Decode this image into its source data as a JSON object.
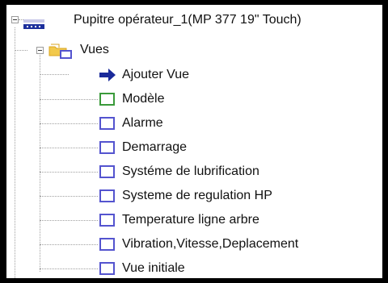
{
  "tree": {
    "root": {
      "label": "Pupitre opérateur_1(MP 377 19\" Touch)",
      "icon": "hmi-device-icon"
    },
    "folder": {
      "label": "Vues",
      "icon": "folder-screens-icon"
    },
    "items": [
      {
        "label": "Ajouter Vue",
        "icon": "add-arrow-icon"
      },
      {
        "label": "Modèle",
        "icon": "template-icon"
      },
      {
        "label": "Alarme",
        "icon": "screen-icon"
      },
      {
        "label": "Demarrage",
        "icon": "screen-icon"
      },
      {
        "label": "Systéme de lubrification",
        "icon": "screen-icon"
      },
      {
        "label": "Systeme de regulation HP",
        "icon": "screen-icon"
      },
      {
        "label": "Temperature ligne arbre",
        "icon": "screen-icon"
      },
      {
        "label": "Vibration,Vitesse,Deplacement",
        "icon": "screen-icon"
      },
      {
        "label": "Vue initiale",
        "icon": "screen-icon"
      }
    ]
  },
  "colors": {
    "screen_border": "#5454cf",
    "template_border": "#3a9a3a",
    "arrow": "#1a2a9a",
    "device": "#1c2f9c"
  }
}
